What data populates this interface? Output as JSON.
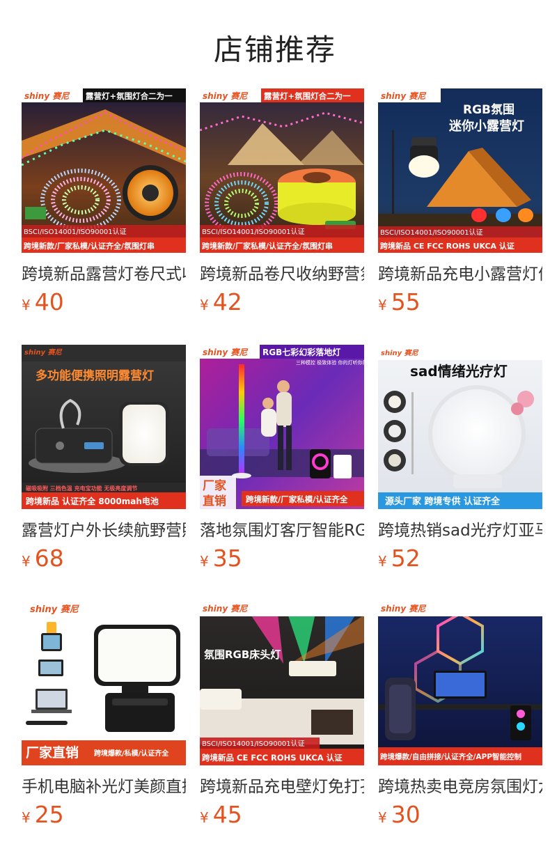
{
  "header": {
    "title": "店铺推荐"
  },
  "currency_symbol": "¥",
  "products": [
    {
      "name": "跨境新品露营灯卷尺式收纳野营灯",
      "price": "40",
      "image": {
        "brand": "shiny 赛尼",
        "top_banner": "露营灯+氛围灯合二为一",
        "cert": "BSCI/ISO14001/ISO90001认证",
        "bottom_banner": "跨境新款/厂家私模/认证齐全/氛围灯串"
      }
    },
    {
      "name": "跨境新品卷尺收纳野营氛围灯",
      "price": "42",
      "image": {
        "brand": "shiny 赛尼",
        "top_banner": "露营灯+氛围灯合二为一",
        "cert": "BSCI/ISO14001/ISO90001认证",
        "bottom_banner": "跨境新款/厂家私模/认证齐全/氛围灯串"
      }
    },
    {
      "name": "跨境新品充电小露营灯便携",
      "price": "55",
      "image": {
        "brand": "shiny 赛尼",
        "headline_1": "RGB氛围",
        "headline_2": "迷你小露营灯",
        "cert": "BSCI/ISO14001/ISO90001认证",
        "bottom_banner": "跨境新品 CE FCC ROHS UKCA 认证"
      }
    },
    {
      "name": "露营灯户外长续航野营照明灯",
      "price": "68",
      "image": {
        "brand": "shiny 赛尼",
        "headline_1": "多功能便携照明露营灯",
        "feature_line": "磁吸吸附 三档色温 充电宝功能 无极亮度调节",
        "bottom_banner": "跨境新品  认证齐全  8000mah电池"
      }
    },
    {
      "name": "落地氛围灯客厅智能RGB落地灯",
      "price": "35",
      "image": {
        "brand": "shiny 赛尼",
        "top_banner": "RGB七彩幻彩落地灯",
        "sub_line": "三种模控 极致体验 你的灯听你的",
        "badge_1": "厂家",
        "badge_2": "直销",
        "bottom_banner": "跨境新款/厂家私模/认证齐全"
      }
    },
    {
      "name": "跨境热销sad光疗灯亚马逊",
      "price": "52",
      "image": {
        "brand": "shiny 赛尼",
        "headline_1": "sad情绪光疗灯",
        "bottom_banner": "源头厂家  跨境专供  认证齐全"
      }
    },
    {
      "name": "手机电脑补光灯美颜直播灯",
      "price": "25",
      "image": {
        "brand": "shiny 赛尼",
        "badge_1": "厂家直销",
        "bottom_banner": "跨境爆款/私模/认证齐全"
      }
    },
    {
      "name": "跨境新品充电壁灯免打孔床头灯",
      "price": "45",
      "image": {
        "brand": "shiny 赛尼",
        "headline_1": "氛围RGB床头灯",
        "cert": "BSCI/ISO14001/ISO90001认证",
        "bottom_banner": "跨境新品 CE FCC ROHS UKCA 认证"
      }
    },
    {
      "name": "跨境热卖电竞房氛围灯六边形",
      "price": "30",
      "image": {
        "brand": "shiny 赛尼",
        "bottom_banner": "跨境爆款/自由拼接/认证齐全/APP智能控制"
      }
    }
  ]
}
